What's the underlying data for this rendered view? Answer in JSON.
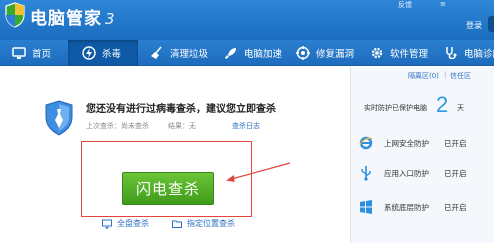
{
  "app": {
    "title": "电脑管家",
    "title_signature": "3"
  },
  "window": {
    "feedback": "反馈",
    "controls_edge": "≡",
    "login": "登录"
  },
  "nav": {
    "items": [
      {
        "label": "首页",
        "icon": "monitor-icon"
      },
      {
        "label": "杀毒",
        "icon": "lightning-shield-icon"
      },
      {
        "label": "清理垃圾",
        "icon": "broom-icon"
      },
      {
        "label": "电脑加速",
        "icon": "rocket-icon"
      },
      {
        "label": "修复漏洞",
        "icon": "patch-icon"
      },
      {
        "label": "软件管理",
        "icon": "gear-icon"
      },
      {
        "label": "电脑诊所",
        "icon": "stethoscope-icon"
      }
    ],
    "active_index": 1
  },
  "scan": {
    "headline": "您还没有进行过病毒查杀，建议您立即查杀",
    "last_scan": "上次查杀：尚未查杀",
    "result": "结果：无",
    "log_link": "查杀日志",
    "quick_scan": "闪电查杀",
    "full_scan": "全盘查杀",
    "custom_scan": "指定位置查杀"
  },
  "side": {
    "quarantine": "隔离区(0)",
    "separator": "|",
    "trust": "信任区",
    "protect_label": "实时防护已保护电脑",
    "protect_days": "2",
    "protect_unit": "天",
    "items": [
      {
        "name": "上网安全防护",
        "status": "已开启",
        "icon": "ie-icon"
      },
      {
        "name": "应用入口防护",
        "status": "已开启",
        "icon": "usb-icon"
      },
      {
        "name": "系统底层防护",
        "status": "已开启",
        "icon": "windows-icon"
      }
    ]
  },
  "colors": {
    "brand_blue": "#1d6cbd",
    "scan_green": "#4ea824",
    "highlight_red": "#e2453c",
    "link_blue": "#2c6fc3"
  }
}
